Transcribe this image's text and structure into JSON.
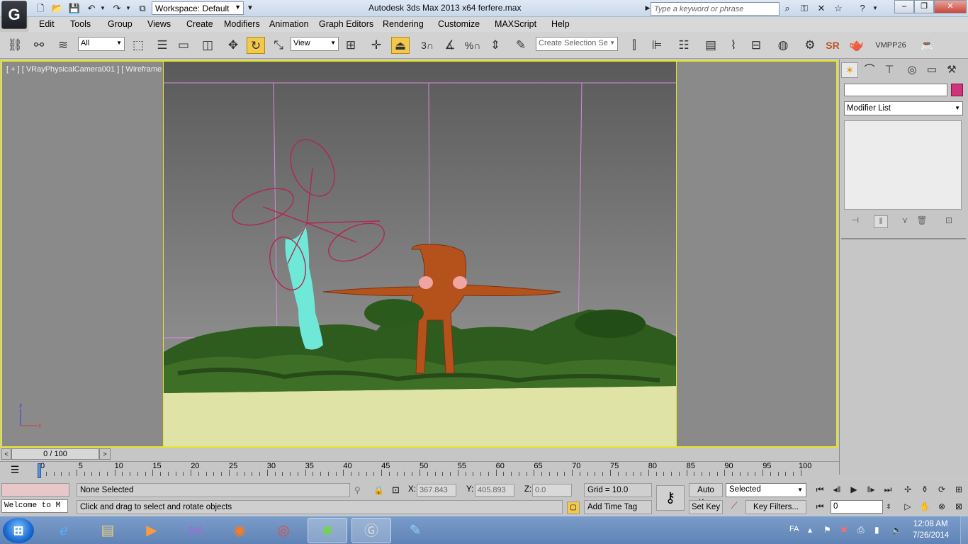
{
  "titlebar": {
    "app_logo": "G",
    "workspace": "Workspace: Default",
    "title": "Autodesk 3ds Max  2013 x64      ferfere.max",
    "search_placeholder": "Type a keyword or phrase"
  },
  "menu": [
    "Edit",
    "Tools",
    "Group",
    "Views",
    "Create",
    "Modifiers",
    "Animation",
    "Graph Editors",
    "Rendering",
    "Customize",
    "MAXScript",
    "Help"
  ],
  "toolbar": {
    "filter": "All",
    "ref_coord": "View",
    "snap_angle_label": "3",
    "percent_label": "%",
    "selection_set_placeholder": "Create Selection Se",
    "sr_label": "SR",
    "vmpp_label": "VMPP26"
  },
  "viewport": {
    "label": "[ + ] [ VRayPhysicalCamera001 ] [ Wireframe ]",
    "axis_z": "z",
    "axis_x": "x"
  },
  "command_panel": {
    "name_value": "",
    "color": "#d0337a",
    "modifier_list": "Modifier List"
  },
  "time_slider": {
    "position": "0 / 100",
    "left": "<",
    "right": ">"
  },
  "trackbar": {
    "ticks": [
      "0",
      "5",
      "10",
      "15",
      "20",
      "25",
      "30",
      "35",
      "40",
      "45",
      "50",
      "55",
      "60",
      "65",
      "70",
      "75",
      "80",
      "85",
      "90",
      "95",
      "100"
    ]
  },
  "status": {
    "listener": "Welcome to M",
    "selection": "None Selected",
    "prompt": "Click and drag to select and rotate objects",
    "x_label": "X:",
    "x_value": "367.843",
    "y_label": "Y:",
    "y_value": "405.893",
    "z_label": "Z:",
    "z_value": "0.0",
    "grid": "Grid = 10.0",
    "add_time_tag": "Add Time Tag",
    "auto_key": "Auto Key",
    "set_key": "Set Key",
    "key_mode": "Selected",
    "key_filters": "Key Filters...",
    "frame": "0"
  },
  "taskbar": {
    "lang": "FA",
    "time": "12:08 AM",
    "date": "7/26/2014"
  }
}
